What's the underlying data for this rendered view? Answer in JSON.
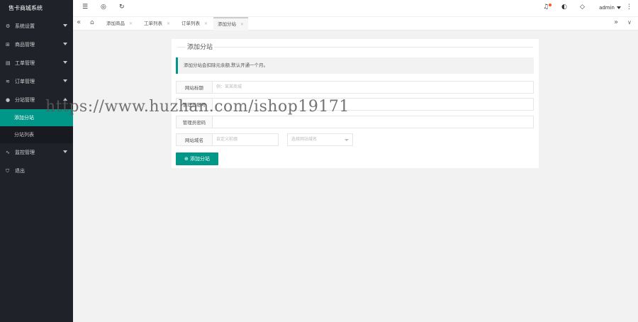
{
  "app": {
    "title": "售卡商城系统"
  },
  "sidebar": {
    "items": [
      {
        "label": "系统设置",
        "icon": "gear-icon"
      },
      {
        "label": "商品管理",
        "icon": "cart-icon"
      },
      {
        "label": "工单管理",
        "icon": "ticket-icon"
      },
      {
        "label": "订单管理",
        "icon": "order-icon"
      },
      {
        "label": "分站管理",
        "icon": "site-icon"
      },
      {
        "label": "监控管理",
        "icon": "monitor-icon"
      },
      {
        "label": "退出",
        "icon": "logout-icon"
      }
    ],
    "sub_items": [
      {
        "label": "添加分站",
        "active": true
      },
      {
        "label": "分站列表",
        "active": false
      }
    ]
  },
  "header": {
    "user": "admin"
  },
  "tabs": [
    {
      "label": "添加商品"
    },
    {
      "label": "工单列表"
    },
    {
      "label": "订单列表"
    },
    {
      "label": "添加分站",
      "active": true
    }
  ],
  "form": {
    "title": "添加分站",
    "notice": "添加分站会扣除元余额,默认开通一个月。",
    "fields": [
      {
        "label": "网站标题",
        "placeholder": "例：某某商城"
      },
      {
        "label": "管理员账号",
        "placeholder": ""
      },
      {
        "label": "管理员密码",
        "placeholder": ""
      },
      {
        "label": "网站域名",
        "placeholder": "自定义前缀",
        "select_placeholder": "选择网站域名"
      }
    ],
    "submit_label": "添加分站"
  },
  "watermark": "https://www.huzhan.com/ishop19171",
  "colors": {
    "accent": "#009688",
    "sidebar": "#20222a",
    "badge": "#ff5722"
  }
}
